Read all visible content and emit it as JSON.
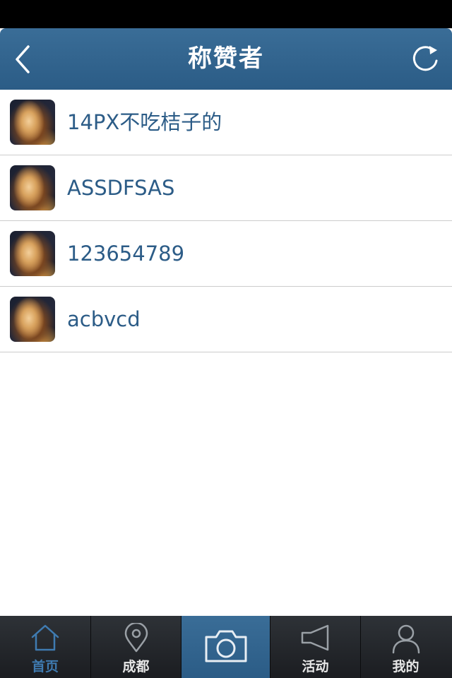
{
  "header": {
    "title": "称赞者",
    "back_icon": "chevron-left-icon",
    "refresh_icon": "refresh-icon"
  },
  "likers": [
    {
      "name": "14PX不吃桔子的",
      "avatar_icon": "avatar"
    },
    {
      "name": "ASSDFSAS",
      "avatar_icon": "avatar"
    },
    {
      "name": "123654789",
      "avatar_icon": "avatar"
    },
    {
      "name": "acbvcd",
      "avatar_icon": "avatar"
    }
  ],
  "tabs": [
    {
      "label": "首页",
      "icon": "home-icon",
      "active": true
    },
    {
      "label": "成都",
      "icon": "location-pin-icon",
      "active": false
    },
    {
      "label": "",
      "icon": "camera-icon",
      "active": false
    },
    {
      "label": "活动",
      "icon": "megaphone-icon",
      "active": false
    },
    {
      "label": "我的",
      "icon": "user-icon",
      "active": false
    }
  ],
  "colors": {
    "nav_bar": "#2e5e88",
    "accent_text": "#2c5c87",
    "tab_active": "#3f7bb1",
    "tab_bar": "#1f2226"
  }
}
